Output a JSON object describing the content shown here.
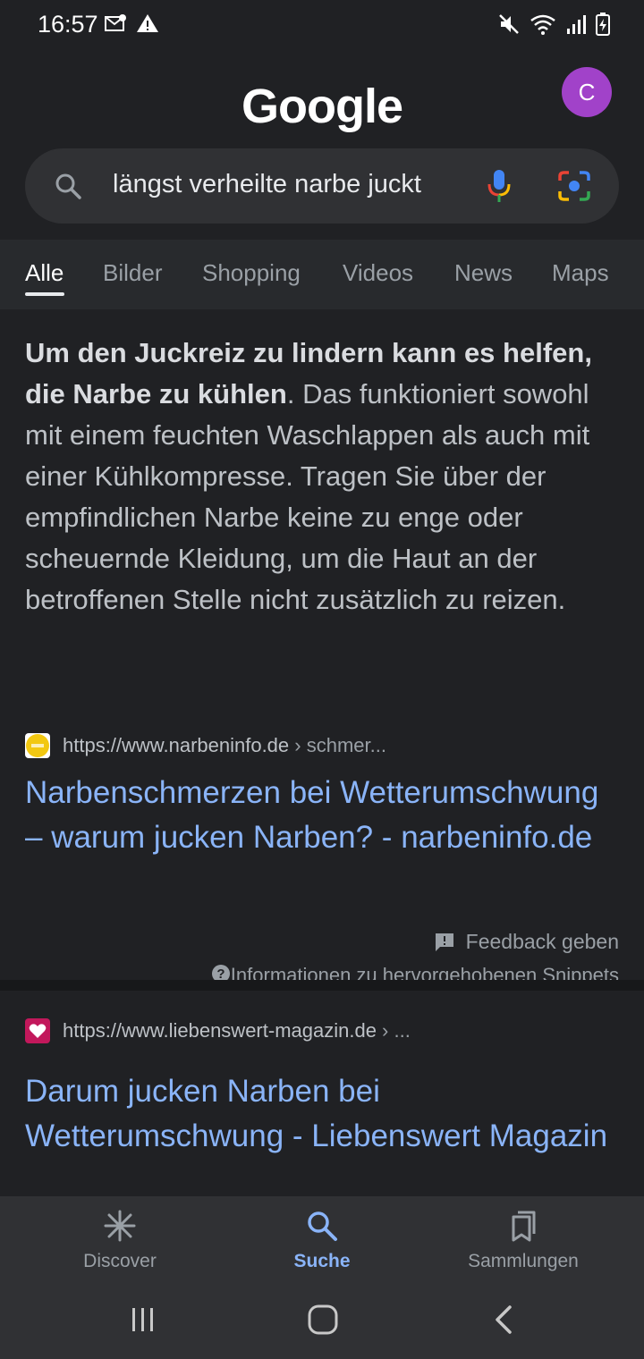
{
  "status": {
    "time": "16:57"
  },
  "header": {
    "logo": "Google",
    "avatar_letter": "C"
  },
  "search": {
    "query": "längst verheilte narbe juckt"
  },
  "tabs": [
    "Alle",
    "Bilder",
    "Shopping",
    "Videos",
    "News",
    "Maps"
  ],
  "snippet": {
    "bold": "Um den Juckreiz zu lindern kann es helfen, die Narbe zu kühlen",
    "rest": ". Das funktioniert sowohl mit einem feuchten Waschlappen als auch mit einer Kühlkompresse. Tragen Sie über der empfindlichen Narbe keine zu enge oder scheuernde Kleidung, um die Haut an der betroffenen Stelle nicht zusätzlich zu reizen."
  },
  "results": [
    {
      "url": "https://www.narbeninfo.de",
      "path": " › schmer...",
      "title": "Narbenschmerzen bei Wetterumschwung – warum jucken Narben? - narbeninfo.de"
    },
    {
      "url": "https://www.liebenswert-magazin.de",
      "path": " › ...",
      "title": "Darum jucken Narben bei Wetterumschwung - Liebenswert Magazin"
    }
  ],
  "feedback_label": "Feedback geben",
  "info_label": "Informationen zu hervorgehobenen Snippets",
  "bottom_nav": {
    "discover": "Discover",
    "suche": "Suche",
    "sammlungen": "Sammlungen"
  },
  "colors": {
    "background": "#202124",
    "link": "#8ab4f8",
    "avatar": "#a142c9",
    "active_nav": "#8ab4f8"
  }
}
